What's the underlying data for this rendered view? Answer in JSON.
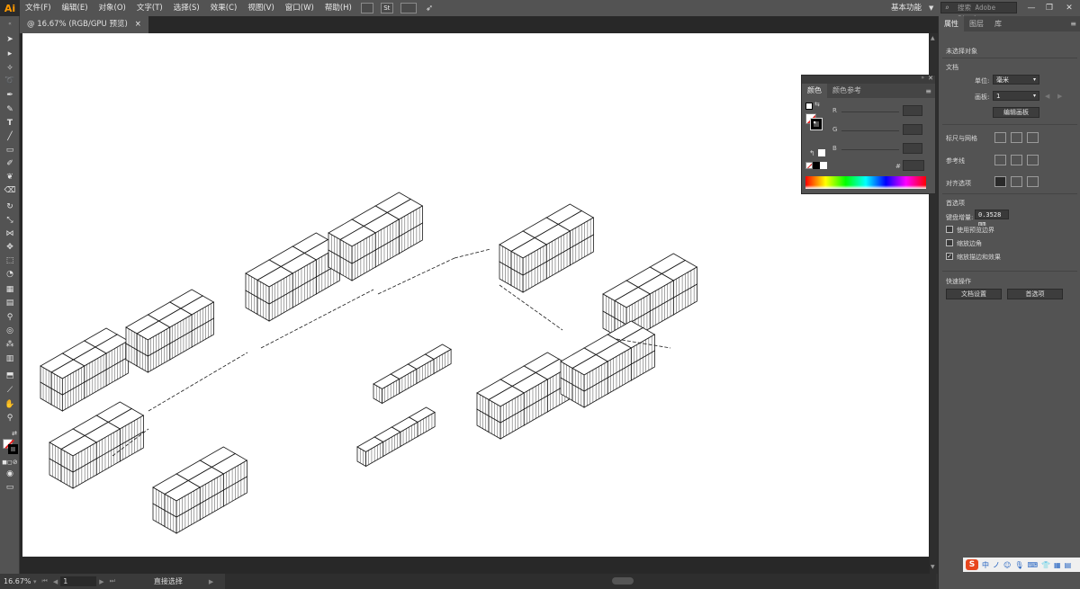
{
  "app": {
    "logo": "Ai",
    "menu": [
      "文件(F)",
      "编辑(E)",
      "对象(O)",
      "文字(T)",
      "选择(S)",
      "效果(C)",
      "视图(V)",
      "窗口(W)",
      "帮助(H)"
    ],
    "menubar_badge": "St",
    "workspace": "基本功能",
    "stock_search_placeholder": "搜索 Adobe Stock"
  },
  "document": {
    "tab_title": "@ 16.67% (RGB/GPU 预览)",
    "tab_close": "×"
  },
  "status": {
    "zoom": "16.67%",
    "page": "1",
    "tool": "直接选择"
  },
  "color_panel": {
    "tabs": [
      "颜色",
      "颜色参考"
    ],
    "channels": [
      "R",
      "G",
      "B"
    ],
    "hex_label": "#"
  },
  "properties_panel": {
    "tabs": [
      "属性",
      "图层",
      "库"
    ],
    "no_selection": "未选择对象",
    "document_section": "文档",
    "units_label": "单位:",
    "units_value": "毫米",
    "artboard_label": "画板:",
    "artboard_value": "1",
    "edit_artboards": "编辑画板",
    "rulers_grids": "标尺与网格",
    "guides": "参考线",
    "snap_options": "对齐选项",
    "preferences": "首选项",
    "keyboard_increment_label": "键盘增量:",
    "keyboard_increment_value": "0.3528 mm",
    "use_preview_bounds": "使用预览边界",
    "scale_corners": "缩放边角",
    "scale_strokes": "缩放描边和效果",
    "quick_actions": "快速操作",
    "doc_setup": "文档设置",
    "prefs_button": "首选项"
  },
  "tray": {
    "ime": "S",
    "items": [
      "中",
      "ノ",
      "☺",
      "🎙",
      "⌨",
      "👕",
      "▦",
      "▤"
    ]
  },
  "colors": {
    "menubar": "#535353",
    "panel": "#535353",
    "canvas": "#282828",
    "artboard": "#ffffff",
    "logo": "#ff9a00"
  }
}
